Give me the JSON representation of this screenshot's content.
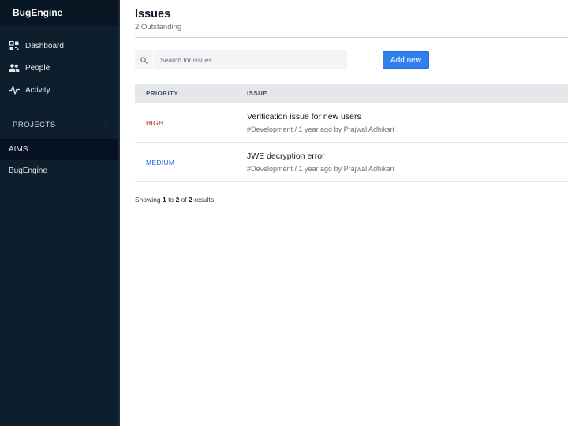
{
  "sidebar": {
    "brand": "BugEngine",
    "nav": [
      {
        "label": "Dashboard",
        "icon": "dashboard-icon"
      },
      {
        "label": "People",
        "icon": "people-icon"
      },
      {
        "label": "Activity",
        "icon": "activity-icon"
      }
    ],
    "projects_label": "PROJECTS",
    "add_project_glyph": "+",
    "projects": [
      {
        "label": "AIMS",
        "active": true
      },
      {
        "label": "BugEngine",
        "active": false
      }
    ]
  },
  "header": {
    "title": "Issues",
    "subtitle": "2 Outstanding"
  },
  "search": {
    "placeholder": "Search for issues...",
    "value": ""
  },
  "toolbar": {
    "add_label": "Add new"
  },
  "table": {
    "columns": [
      "PRIORITY",
      "ISSUE"
    ],
    "rows": [
      {
        "priority": "HIGH",
        "priority_color": "#b91c1c",
        "title": "Verification issue for new users",
        "meta": "#Development / 1 year ago by Prajwal Adhikari"
      },
      {
        "priority": "MEDIUM",
        "priority_color": "#2563eb",
        "title": "JWE decryption error",
        "meta": "#Development / 1 year ago by Prajwal Adhikari"
      }
    ]
  },
  "pagination": {
    "prefix": "Showing",
    "from": "1",
    "to_word": "to",
    "to": "2",
    "of_word": "of",
    "total": "2",
    "suffix": "results"
  },
  "colors": {
    "sidebar_bg": "#0d1f2d",
    "accent": "#2f80ed"
  }
}
